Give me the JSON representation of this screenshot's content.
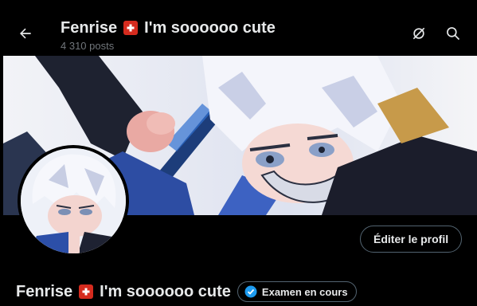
{
  "header": {
    "name": "Fenrise",
    "emoji": "🇨🇭",
    "tagline": "I'm soooooo cute",
    "posts": "4 310 posts"
  },
  "profile": {
    "edit_button": "Éditer le profil",
    "name": "Fenrise",
    "emoji": "🇨🇭",
    "tagline": "I'm soooooo cute",
    "badge_label": "Examen en cours"
  },
  "colors": {
    "accent": "#1d9bf0",
    "border": "#536471",
    "muted": "#71767b",
    "flag": "#d52b1e"
  }
}
